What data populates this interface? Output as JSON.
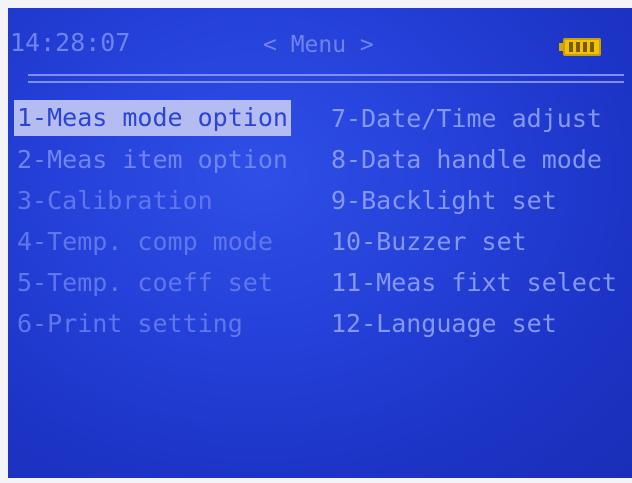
{
  "status_bar": {
    "time": "14:28:07",
    "title": "< Menu >",
    "battery_icon": "battery-full-icon"
  },
  "menu": {
    "left_items": [
      {
        "label": "1-Meas mode option",
        "selected": true
      },
      {
        "label": "2-Meas item option",
        "selected": false
      },
      {
        "label": "3-Calibration",
        "selected": false
      },
      {
        "label": "4-Temp. comp mode",
        "selected": false
      },
      {
        "label": "5-Temp. coeff set",
        "selected": false
      },
      {
        "label": "6-Print setting",
        "selected": false
      }
    ],
    "right_items": [
      {
        "label": "7-Date/Time adjust",
        "selected": false
      },
      {
        "label": "8-Data handle mode",
        "selected": false
      },
      {
        "label": "9-Backlight set",
        "selected": false
      },
      {
        "label": "10-Buzzer set",
        "selected": false
      },
      {
        "label": "11-Meas fixt select",
        "selected": false
      },
      {
        "label": "12-Language set",
        "selected": false
      }
    ]
  },
  "colors": {
    "screen_bg": "#2440d8",
    "text": "#6f84f0",
    "highlight_bg": "#b4bcf2",
    "highlight_text": "#2b44d2",
    "battery": "#f2c200"
  }
}
